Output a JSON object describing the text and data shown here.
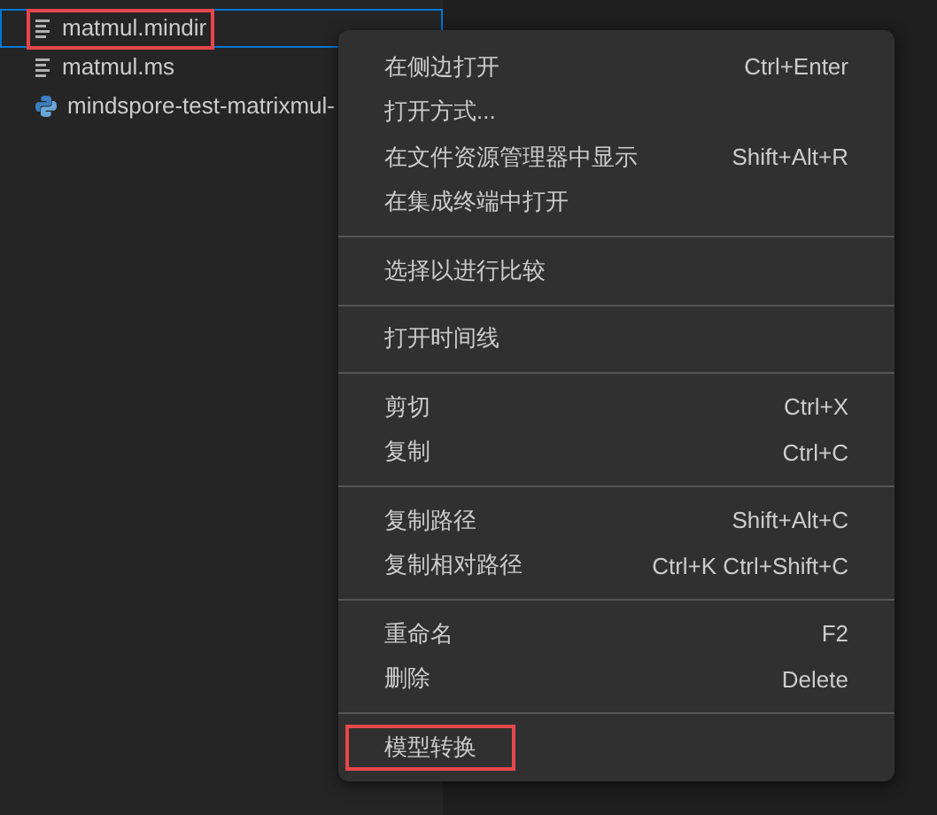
{
  "files": [
    {
      "name": "matmul.mindir",
      "kind": "text",
      "selected": true,
      "highlighted": true
    },
    {
      "name": "matmul.ms",
      "kind": "text",
      "selected": false,
      "highlighted": false
    },
    {
      "name": "mindspore-test-matrixmul-",
      "kind": "python",
      "selected": false,
      "highlighted": false
    }
  ],
  "context_menu": {
    "groups": [
      [
        {
          "label": "在侧边打开",
          "shortcut": "Ctrl+Enter",
          "highlighted": false
        },
        {
          "label": "打开方式...",
          "highlighted": false
        },
        {
          "label": "在文件资源管理器中显示",
          "shortcut": "Shift+Alt+R",
          "highlighted": false
        },
        {
          "label": "在集成终端中打开",
          "highlighted": false
        }
      ],
      [
        {
          "label": "选择以进行比较",
          "highlighted": false
        }
      ],
      [
        {
          "label": "打开时间线",
          "highlighted": false
        }
      ],
      [
        {
          "label": "剪切",
          "shortcut": "Ctrl+X",
          "highlighted": false
        },
        {
          "label": "复制",
          "shortcut": "Ctrl+C",
          "highlighted": false
        }
      ],
      [
        {
          "label": "复制路径",
          "shortcut": "Shift+Alt+C",
          "highlighted": false
        },
        {
          "label": "复制相对路径",
          "shortcut": "Ctrl+K Ctrl+Shift+C",
          "highlighted": false
        }
      ],
      [
        {
          "label": "重命名",
          "shortcut": "F2",
          "highlighted": false
        },
        {
          "label": "删除",
          "shortcut": "Delete",
          "highlighted": false
        }
      ],
      [
        {
          "label": "模型转换",
          "highlighted": true
        }
      ]
    ]
  }
}
